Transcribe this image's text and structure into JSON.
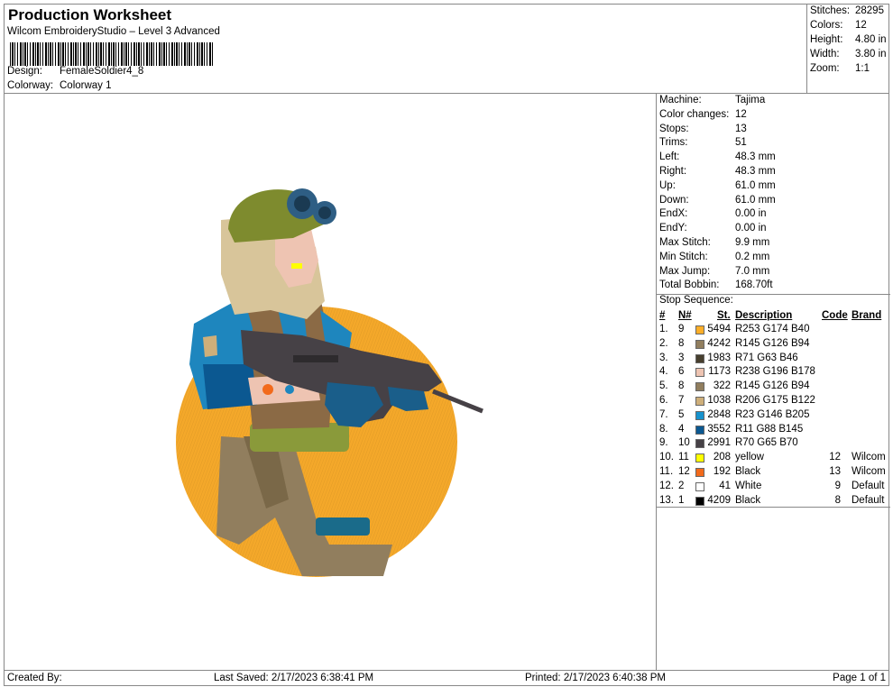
{
  "header": {
    "title": "Production Worksheet",
    "software": "Wilcom EmbroideryStudio – Level 3 Advanced",
    "design_label": "Design:",
    "design_value": "FemaleSoldier4_8",
    "colorway_label": "Colorway:",
    "colorway_value": "Colorway 1"
  },
  "stats": [
    {
      "label": "Stitches:",
      "value": "28295"
    },
    {
      "label": "Colors:",
      "value": "12"
    },
    {
      "label": "Height:",
      "value": "4.80 in"
    },
    {
      "label": "Width:",
      "value": "3.80 in"
    },
    {
      "label": "Zoom:",
      "value": "1:1"
    }
  ],
  "machine_info": [
    {
      "label": "Machine:",
      "value": "Tajima"
    },
    {
      "label": "Color changes:",
      "value": "12"
    },
    {
      "label": "Stops:",
      "value": "13"
    },
    {
      "label": "Trims:",
      "value": "51"
    },
    {
      "label": "Left:",
      "value": "48.3 mm"
    },
    {
      "label": "Right:",
      "value": "48.3 mm"
    },
    {
      "label": "Up:",
      "value": "61.0 mm"
    },
    {
      "label": "Down:",
      "value": "61.0 mm"
    },
    {
      "label": "EndX:",
      "value": "0.00 in"
    },
    {
      "label": "EndY:",
      "value": "0.00 in"
    },
    {
      "label": "Max Stitch:",
      "value": "9.9 mm"
    },
    {
      "label": "Min Stitch:",
      "value": "0.2 mm"
    },
    {
      "label": "Max Jump:",
      "value": "7.0 mm"
    },
    {
      "label": "Total Bobbin:",
      "value": "168.70ft"
    }
  ],
  "stop_sequence": {
    "title": "Stop Sequence:",
    "headers": {
      "num": "#",
      "n": "N#",
      "st": "St.",
      "desc": "Description",
      "code": "Code",
      "brand": "Brand"
    },
    "rows": [
      {
        "num": "1.",
        "n": "9",
        "color": "#FDAE28",
        "st": "5494",
        "desc": "R253 G174 B40",
        "code": "",
        "brand": ""
      },
      {
        "num": "2.",
        "n": "8",
        "color": "#917E5E",
        "st": "4242",
        "desc": "R145 G126 B94",
        "code": "",
        "brand": ""
      },
      {
        "num": "3.",
        "n": "3",
        "color": "#473F2E",
        "st": "1983",
        "desc": "R71 G63 B46",
        "code": "",
        "brand": ""
      },
      {
        "num": "4.",
        "n": "6",
        "color": "#EEC4B2",
        "st": "1173",
        "desc": "R238 G196 B178",
        "code": "",
        "brand": ""
      },
      {
        "num": "5.",
        "n": "8",
        "color": "#917E5E",
        "st": "322",
        "desc": "R145 G126 B94",
        "code": "",
        "brand": ""
      },
      {
        "num": "6.",
        "n": "7",
        "color": "#CEAF7A",
        "st": "1038",
        "desc": "R206 G175 B122",
        "code": "",
        "brand": ""
      },
      {
        "num": "7.",
        "n": "5",
        "color": "#1792CD",
        "st": "2848",
        "desc": "R23 G146 B205",
        "code": "",
        "brand": ""
      },
      {
        "num": "8.",
        "n": "4",
        "color": "#0B5891",
        "st": "3552",
        "desc": "R11 G88 B145",
        "code": "",
        "brand": ""
      },
      {
        "num": "9.",
        "n": "10",
        "color": "#464146",
        "st": "2991",
        "desc": "R70 G65 B70",
        "code": "",
        "brand": ""
      },
      {
        "num": "10.",
        "n": "11",
        "color": "#FFFF00",
        "st": "208",
        "desc": "yellow",
        "code": "12",
        "brand": "Wilcom"
      },
      {
        "num": "11.",
        "n": "12",
        "color": "#F26A1B",
        "st": "192",
        "desc": "Black",
        "code": "13",
        "brand": "Wilcom"
      },
      {
        "num": "12.",
        "n": "2",
        "color": "#FFFFFF",
        "st": "41",
        "desc": "White",
        "code": "9",
        "brand": "Default"
      },
      {
        "num": "13.",
        "n": "1",
        "color": "#000000",
        "st": "4209",
        "desc": "Black",
        "code": "8",
        "brand": "Default"
      }
    ]
  },
  "footer": {
    "created_by": "Created By:",
    "last_saved": "Last Saved: 2/17/2023 6:38:41 PM",
    "printed": "Printed: 2/17/2023 6:40:38 PM",
    "page": "Page 1 of 1"
  },
  "design_colors": {
    "background_oval": "#F4A82A",
    "helmet": "#7E8B2E",
    "goggles": "#2E5E84",
    "hair": "#D8C59A",
    "skin": "#EEC4B2",
    "jacket": "#1E86BE",
    "jacket_shadow": "#0B5891",
    "vest": "#8B6A45",
    "pants": "#917E5E",
    "belt": "#8A9A3A",
    "rifle": "#464146",
    "glove": "#1A5E8A",
    "leg_strap": "#1A6B8A"
  }
}
